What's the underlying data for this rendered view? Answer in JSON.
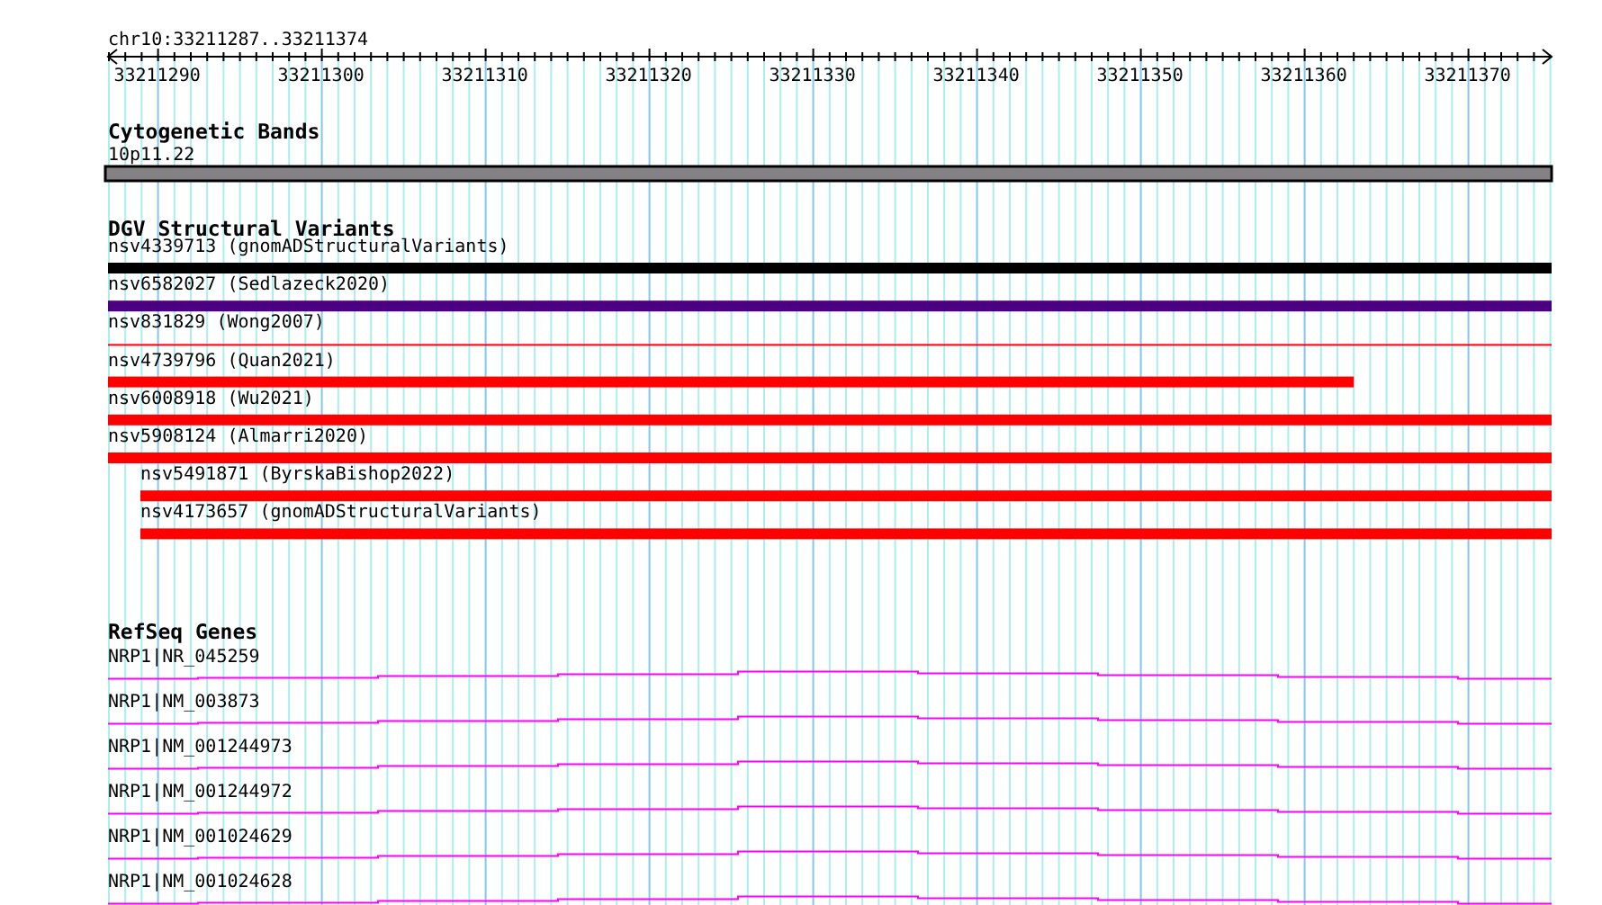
{
  "ruler": {
    "location": "chr10:33211287..33211374",
    "ticks": [
      "33211290",
      "33211300",
      "33211310",
      "33211320",
      "33211330",
      "33211340",
      "33211350",
      "33211360",
      "33211370"
    ]
  },
  "tracks": [
    {
      "kind": "cytoband",
      "title": "Cytogenetic Bands",
      "bands": [
        {
          "name": "10p11.22",
          "color": "#858285"
        }
      ]
    },
    {
      "kind": "variants",
      "title": "DGV Structural Variants",
      "items": [
        {
          "label": "nsv4339713 (gnomADStructuralVariants)",
          "color": "#000000",
          "kind": "bar",
          "indented": false,
          "level": 1
        },
        {
          "label": "nsv6582027 (Sedlazeck2020)",
          "color": "#4b0082",
          "kind": "bar",
          "indented": false,
          "level": 1
        },
        {
          "label": "nsv831829 (Wong2007)",
          "color": "#ff0000",
          "kind": "line",
          "indented": false,
          "level": 1
        },
        {
          "label": "nsv4739796 (Quan2021)",
          "color": "#ff0000",
          "kind": "bar",
          "indented": false,
          "level": 0.863
        },
        {
          "label": "nsv6008918 (Wu2021)",
          "color": "#ff0000",
          "kind": "bar",
          "indented": false,
          "level": 1
        },
        {
          "label": "nsv5908124 (Almarri2020)",
          "color": "#ff0000",
          "kind": "bar",
          "indented": false,
          "level": 1
        },
        {
          "label": "nsv5491871 (ByrskaBishop2022)",
          "color": "#ff0000",
          "kind": "bar",
          "indented": true,
          "level": 1
        },
        {
          "label": "nsv4173657 (gnomADStructuralVariants)",
          "color": "#ff0000",
          "kind": "bar",
          "indented": true,
          "level": 1
        }
      ]
    },
    {
      "kind": "genes",
      "title": "RefSeq Genes",
      "items": [
        {
          "label": "NRP1|NR_045259"
        },
        {
          "label": "NRP1|NM_003873"
        },
        {
          "label": "NRP1|NM_001244973"
        },
        {
          "label": "NRP1|NM_001244972"
        },
        {
          "label": "NRP1|NM_001024629"
        },
        {
          "label": "NRP1|NM_001024628"
        }
      ]
    }
  ]
}
